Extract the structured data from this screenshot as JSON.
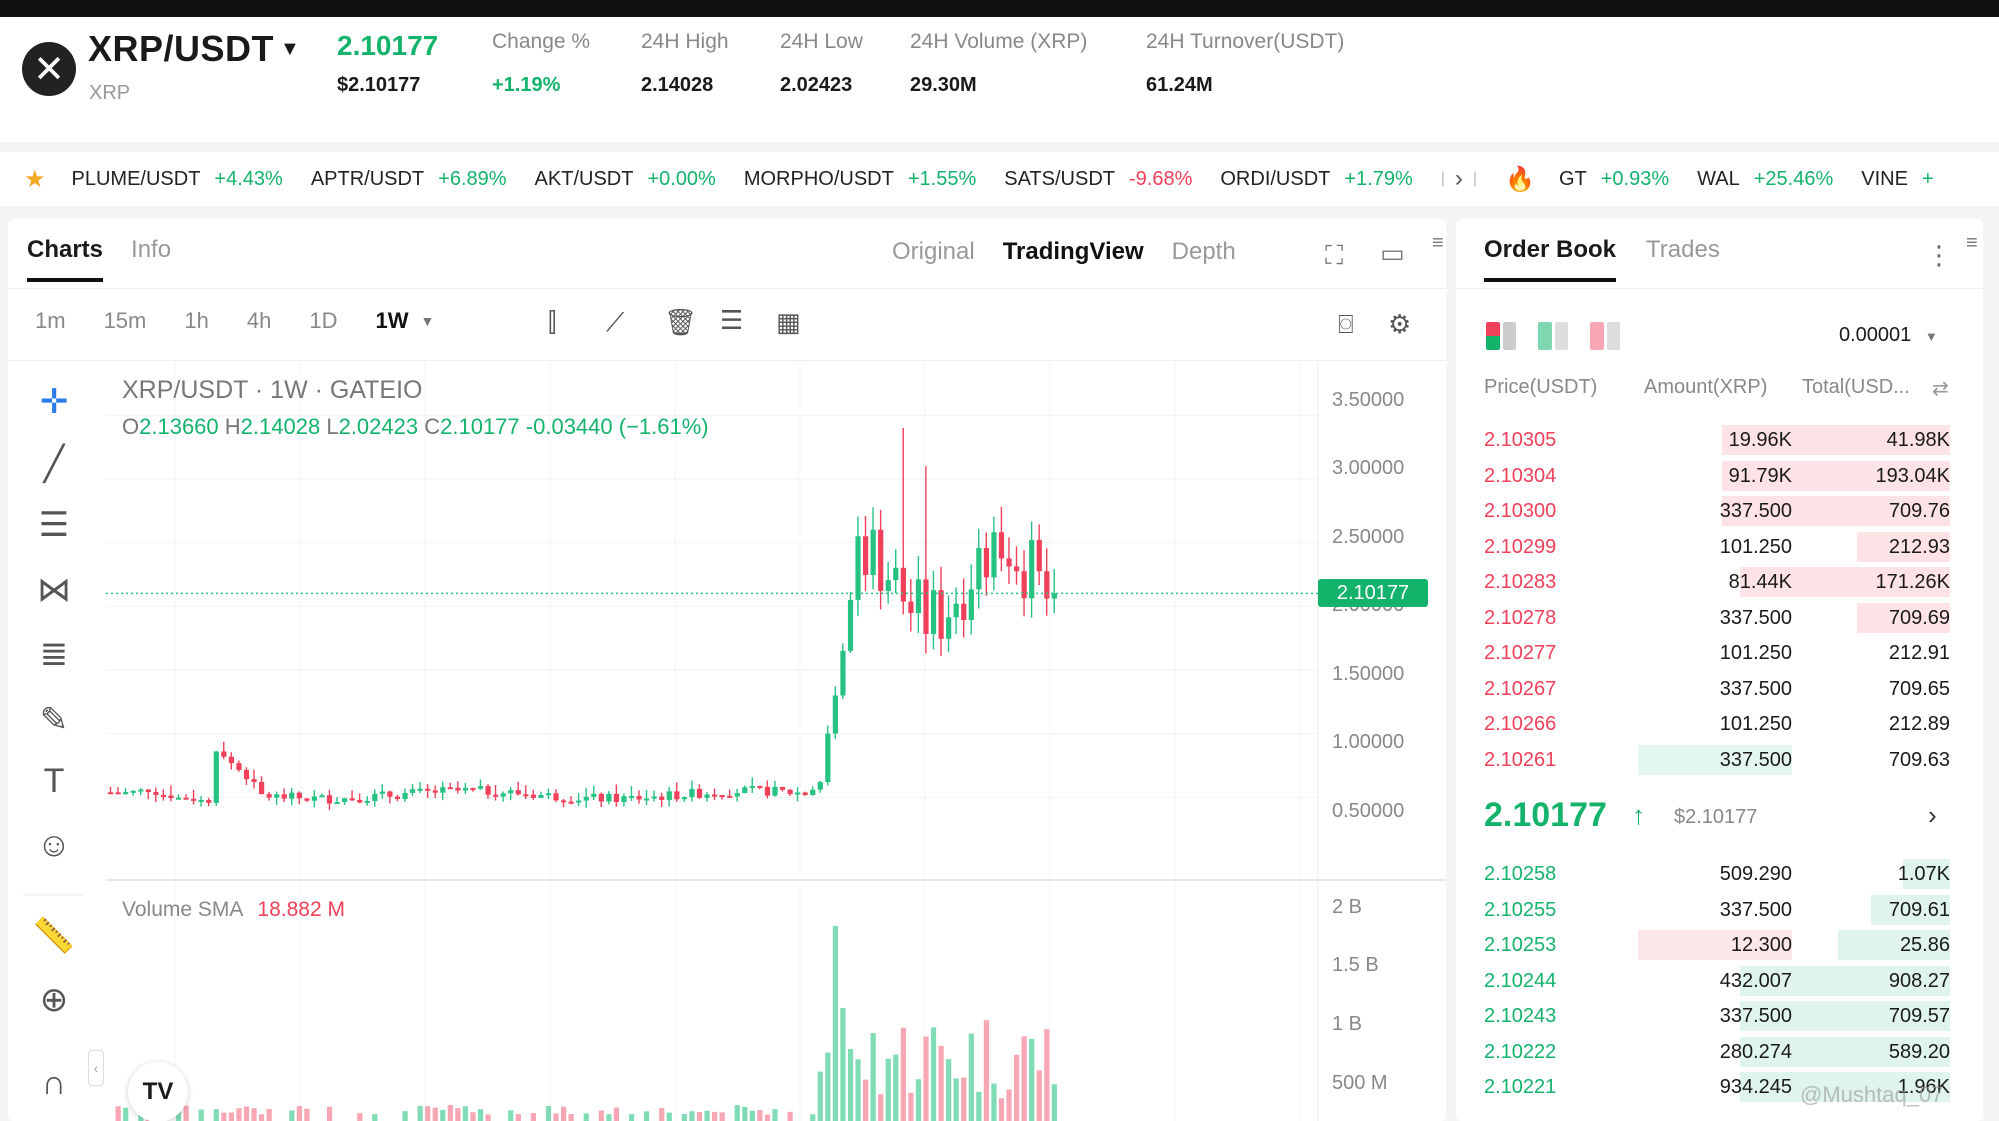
{
  "header": {
    "pair": "XRP/USDT",
    "pair_sub": "XRP",
    "last_price": "2.10177",
    "last_price_usd": "$2.10177",
    "stats": [
      {
        "label": "Change %",
        "value": "+1.19%",
        "tone": "green"
      },
      {
        "label": "24H High",
        "value": "2.14028",
        "tone": "dark"
      },
      {
        "label": "24H Low",
        "value": "2.02423",
        "tone": "dark"
      },
      {
        "label": "24H Volume (XRP)",
        "value": "29.30M",
        "tone": "dark"
      },
      {
        "label": "24H Turnover(USDT)",
        "value": "61.24M",
        "tone": "dark"
      }
    ]
  },
  "ticker": {
    "favorites": [
      {
        "symbol": "PLUME/USDT",
        "change": "+4.43%",
        "tone": "green"
      },
      {
        "symbol": "APTR/USDT",
        "change": "+6.89%",
        "tone": "green"
      },
      {
        "symbol": "AKT/USDT",
        "change": "+0.00%",
        "tone": "green"
      },
      {
        "symbol": "MORPHO/USDT",
        "change": "+1.55%",
        "tone": "green"
      },
      {
        "symbol": "SATS/USDT",
        "change": "-9.68%",
        "tone": "red"
      },
      {
        "symbol": "ORDI/USDT",
        "change": "+1.79%",
        "tone": "green"
      }
    ],
    "hot": [
      {
        "symbol": "GT",
        "change": "+0.93%",
        "tone": "green"
      },
      {
        "symbol": "WAL",
        "change": "+25.46%",
        "tone": "green"
      },
      {
        "symbol": "VINE",
        "change": "+",
        "tone": "green"
      }
    ]
  },
  "chart_panel": {
    "tabs": [
      "Charts",
      "Info"
    ],
    "views": [
      "Original",
      "TradingView",
      "Depth"
    ],
    "intervals": [
      "1m",
      "15m",
      "1h",
      "4h",
      "1D",
      "1W"
    ],
    "active_interval": "1W",
    "title": "XRP/USDT · 1W · GATEIO",
    "ohlc": {
      "o_label": "O",
      "o": "2.13660",
      "h_label": "H",
      "h": "2.14028",
      "l_label": "L",
      "l": "2.02423",
      "c_label": "C",
      "c": "2.10177",
      "chg": "-0.03440 (−1.61%)"
    },
    "current_price_label": "2.10177",
    "volume_label": "Volume SMA",
    "volume_value": "18.882 M",
    "tv_logo": "TV"
  },
  "chart_data": {
    "type": "candlestick",
    "price_axis": [
      "3.50000",
      "3.00000",
      "2.50000",
      "2.00000",
      "1.50000",
      "1.00000",
      "0.50000"
    ],
    "price_range": [
      0.22,
      3.62
    ],
    "volume_axis": [
      "2 B",
      "1.5 B",
      "1 B",
      "500 M"
    ],
    "volume_range": [
      0,
      2200
    ],
    "current_price": 2.10177,
    "note_units": "price in USDT, volume in millions"
  },
  "order_book": {
    "tabs": [
      "Order Book",
      "Trades"
    ],
    "precision": "0.00001",
    "headers": {
      "price": "Price(USDT)",
      "amount": "Amount(XRP)",
      "total": "Total(USD..."
    },
    "asks": [
      {
        "price": "2.10305",
        "amount": "19.96K",
        "total": "41.98K",
        "depth": 0.49
      },
      {
        "price": "2.10304",
        "amount": "91.79K",
        "total": "193.04K",
        "depth": 0.49
      },
      {
        "price": "2.10300",
        "amount": "337.500",
        "total": "709.76",
        "depth": 0.49
      },
      {
        "price": "2.10299",
        "amount": "101.250",
        "total": "212.93",
        "depth": 0.2
      },
      {
        "price": "2.10283",
        "amount": "81.44K",
        "total": "171.26K",
        "depth": 0.45
      },
      {
        "price": "2.10278",
        "amount": "337.500",
        "total": "709.69",
        "depth": 0.2
      },
      {
        "price": "2.10277",
        "amount": "101.250",
        "total": "212.91",
        "depth": 0
      },
      {
        "price": "2.10267",
        "amount": "337.500",
        "total": "709.65",
        "depth": 0
      },
      {
        "price": "2.10266",
        "amount": "101.250",
        "total": "212.89",
        "depth": 0
      },
      {
        "price": "2.10261",
        "amount": "337.500",
        "total": "709.63",
        "depth": 0,
        "highlight": "green"
      }
    ],
    "mid_price": "2.10177",
    "mid_arrow": "↑",
    "mid_usd": "$2.10177",
    "bids": [
      {
        "price": "2.10258",
        "amount": "509.290",
        "total": "1.07K",
        "depth": 0.1
      },
      {
        "price": "2.10255",
        "amount": "337.500",
        "total": "709.61",
        "depth": 0.17
      },
      {
        "price": "2.10253",
        "amount": "12.300",
        "total": "25.86",
        "depth": 0.24,
        "highlight": "red"
      },
      {
        "price": "2.10244",
        "amount": "432.007",
        "total": "908.27",
        "depth": 0.45
      },
      {
        "price": "2.10243",
        "amount": "337.500",
        "total": "709.57",
        "depth": 0.45
      },
      {
        "price": "2.10222",
        "amount": "280.274",
        "total": "589.20",
        "depth": 0.45
      },
      {
        "price": "2.10221",
        "amount": "934.245",
        "total": "1.96K",
        "depth": 0.45
      }
    ]
  },
  "watermark": "@Mushtaq_07"
}
